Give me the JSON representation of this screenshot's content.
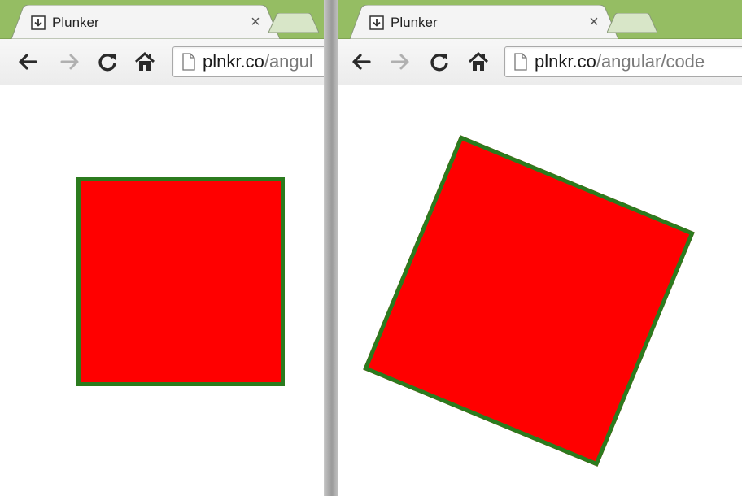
{
  "colors": {
    "tabstrip": "#95bd63",
    "square_fill": "#ff0000",
    "square_border": "#2b7b1e"
  },
  "windows": [
    {
      "tab": {
        "title": "Plunker",
        "close_label": "×",
        "favicon": "download-icon"
      },
      "toolbar": {
        "back_icon": "back-arrow-icon",
        "forward_icon": "forward-arrow-icon",
        "reload_icon": "reload-icon",
        "home_icon": "home-icon"
      },
      "address": {
        "host": "plnkr.co",
        "path": "/angul",
        "page_icon": "page-icon"
      }
    },
    {
      "tab": {
        "title": "Plunker",
        "close_label": "×",
        "favicon": "download-icon"
      },
      "toolbar": {
        "back_icon": "back-arrow-icon",
        "forward_icon": "forward-arrow-icon",
        "reload_icon": "reload-icon",
        "home_icon": "home-icon"
      },
      "address": {
        "host": "plnkr.co",
        "path": "/angular/code",
        "page_icon": "page-icon"
      },
      "square_rotation_deg": 22.5
    }
  ]
}
